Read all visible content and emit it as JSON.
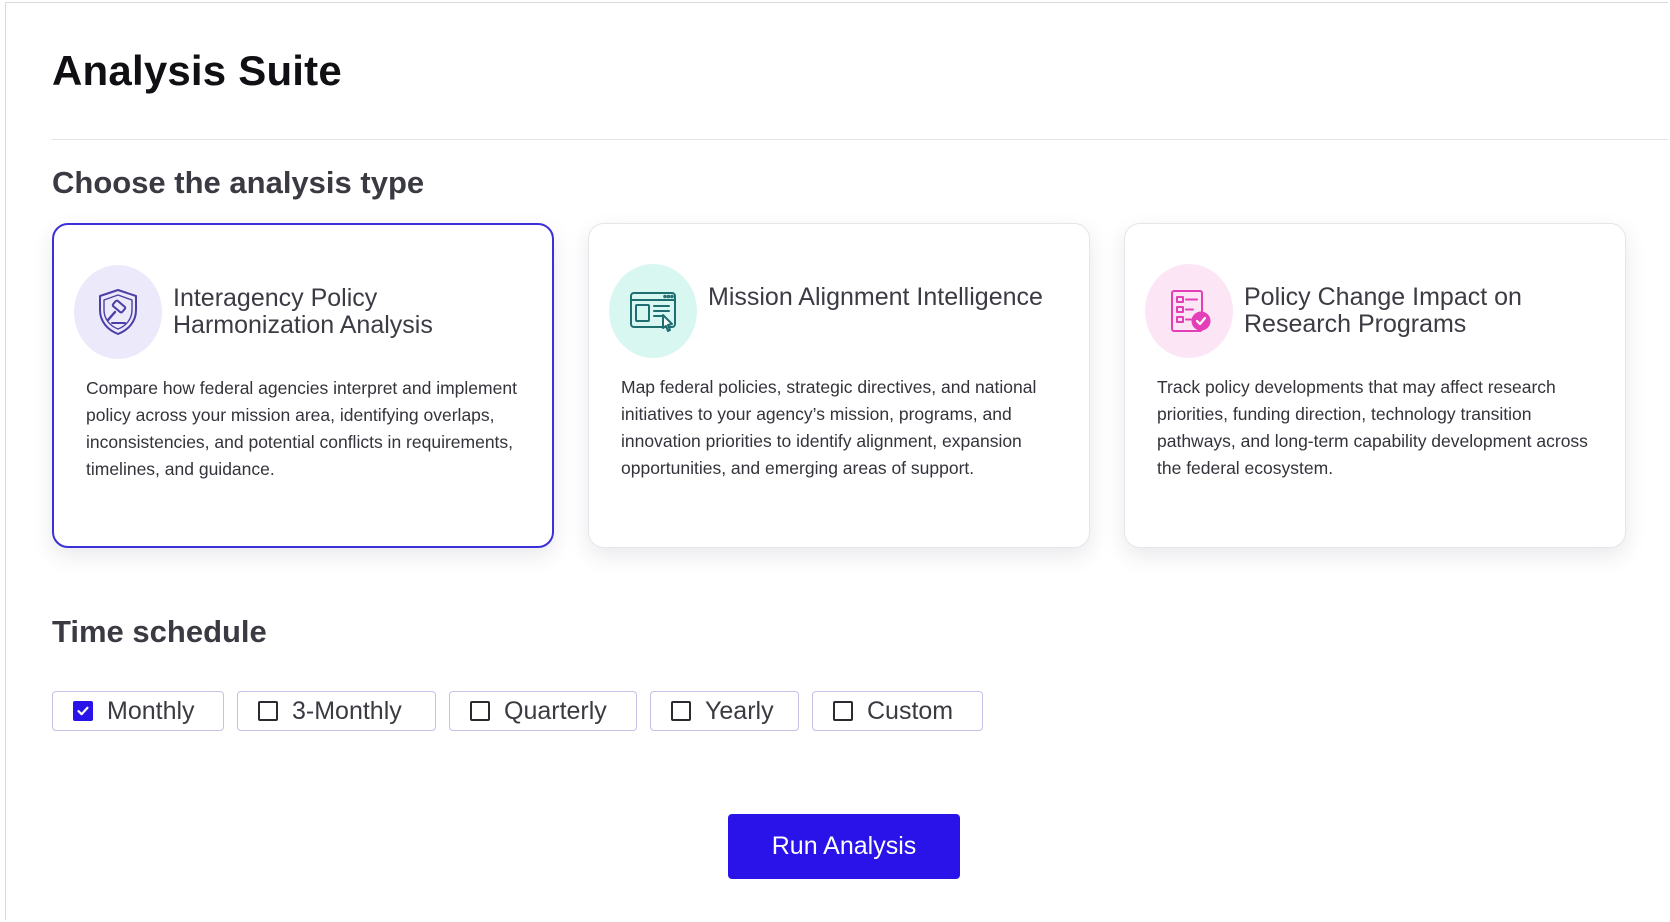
{
  "page": {
    "title": "Analysis Suite"
  },
  "analysis_section": {
    "title": "Choose the analysis type",
    "selected_index": 0,
    "cards": [
      {
        "icon": "shield-gavel-icon",
        "icon_bg": "#ece9fb",
        "icon_color": "#4b3fa6",
        "title": "Interagency Policy Harmonization Analysis",
        "description": "Compare how federal agencies interpret and implement policy across your mission area, identifying overlaps, inconsistencies, and potential conflicts in requirements, timelines, and guidance."
      },
      {
        "icon": "browser-window-cursor-icon",
        "icon_bg": "#d9f7f1",
        "icon_color": "#1f6e72",
        "title": "Mission Alignment Intelligence",
        "description": "Map federal policies, strategic directives, and national initiatives to your agency’s mission, programs, and innovation priorities to identify alignment, expansion opportunities, and emerging areas of support."
      },
      {
        "icon": "checklist-badge-icon",
        "icon_bg": "#fce6f6",
        "icon_color": "#e43fb8",
        "title": "Policy Change Impact on Research Programs",
        "description": "Track policy developments that may affect research priorities, funding direction, technology transition pathways, and long-term capability development across the federal ecosystem."
      }
    ]
  },
  "schedule_section": {
    "title": "Time schedule",
    "options": [
      {
        "label": "Monthly",
        "checked": true
      },
      {
        "label": "3-Monthly",
        "checked": false
      },
      {
        "label": "Quarterly",
        "checked": false
      },
      {
        "label": "Yearly",
        "checked": false
      },
      {
        "label": "Custom",
        "checked": false
      }
    ]
  },
  "actions": {
    "run_label": "Run Analysis"
  },
  "colors": {
    "accent": "#2a13e8",
    "selected_border": "#3d2fd9"
  }
}
